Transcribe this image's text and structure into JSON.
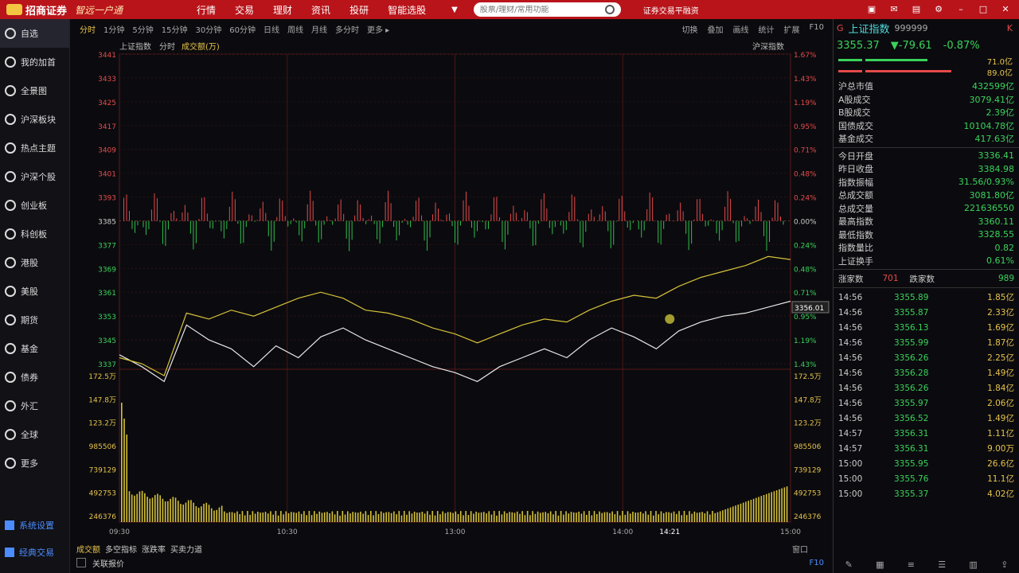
{
  "app": {
    "brand": "招商证券",
    "slogan": "智远一户通"
  },
  "nav": [
    "行情",
    "交易",
    "理财",
    "资讯",
    "投研",
    "智能选股"
  ],
  "search": {
    "placeholder": "股票/理财/常用功能"
  },
  "top_right": "证券交易平融资",
  "sidebar": {
    "items": [
      "自选",
      "我的加首",
      "全景图",
      "沪深板块",
      "热点主题",
      "沪深个股",
      "创业板",
      "科创板",
      "港股",
      "美股",
      "期货",
      "基金",
      "债券",
      "外汇",
      "全球",
      "更多"
    ],
    "bottom": [
      "系统设置",
      "经典交易"
    ]
  },
  "periods": [
    "分时",
    "1分钟",
    "5分钟",
    "15分钟",
    "30分钟",
    "60分钟",
    "日线",
    "周线",
    "月线",
    "多分时",
    "更多 ▸"
  ],
  "chart_tools": [
    "切换",
    "叠加",
    "画线",
    "统计",
    "扩展",
    "F10"
  ],
  "info": {
    "index_name": "上证指数",
    "mode": "分时",
    "indicator": "成交额(万)",
    "right_label": "沪深指数"
  },
  "chart_data": {
    "type": "line",
    "title": "上证指数 分时",
    "time_labels": [
      "09:30",
      "10:30",
      "13:00",
      "14:00",
      "14:21",
      "15:00"
    ],
    "price_ticks": [
      "3441",
      "3433",
      "3425",
      "3417",
      "3409",
      "3401",
      "3393",
      "3385",
      "3377",
      "3369",
      "3361",
      "3353",
      "3345",
      "3337"
    ],
    "pct_ticks": [
      "1.67%",
      "1.43%",
      "1.19%",
      "0.95%",
      "0.71%",
      "0.48%",
      "0.24%",
      "0.00%",
      "0.24%",
      "0.48%",
      "0.71%",
      "0.95%",
      "1.19%",
      "1.43%"
    ],
    "volume_ticks": [
      "172.5万",
      "147.8万",
      "123.2万",
      "985506",
      "739129",
      "492753",
      "246376"
    ],
    "prev_close": 3384.98,
    "current_price_label": "3356.01",
    "series": [
      {
        "name": "上证指数",
        "color": "#e8e8e8",
        "values": [
          3340,
          3336,
          3331,
          3350,
          3345,
          3342,
          3336,
          3343,
          3339,
          3346,
          3349,
          3345,
          3342,
          3339,
          3336,
          3334,
          3331,
          3336,
          3339,
          3342,
          3339,
          3345,
          3349,
          3346,
          3342,
          3348,
          3351,
          3353,
          3354,
          3356,
          3358
        ]
      },
      {
        "name": "均价",
        "color": "#d6c23a",
        "values": [
          3339,
          3337,
          3333,
          3354,
          3352,
          3355,
          3353,
          3356,
          3359,
          3361,
          3359,
          3355,
          3354,
          3352,
          3349,
          3347,
          3344,
          3347,
          3350,
          3352,
          3351,
          3355,
          3358,
          3360,
          3359,
          3363,
          3366,
          3368,
          3370,
          3373,
          3372
        ]
      }
    ]
  },
  "quote": {
    "flag": "G",
    "name": "上证指数",
    "code": "999999",
    "kline": "K",
    "price": "3355.37",
    "change": "▼-79.61",
    "pct": "-0.87%",
    "bar_up": "71.0亿",
    "bar_down": "89.0亿"
  },
  "quote_rows1": [
    {
      "label": "沪总市值",
      "value": "432599亿"
    },
    {
      "label": "A股成交",
      "value": "3079.41亿"
    },
    {
      "label": "B股成交",
      "value": "2.39亿"
    },
    {
      "label": "国债成交",
      "value": "10104.78亿"
    },
    {
      "label": "基金成交",
      "value": "417.63亿"
    }
  ],
  "quote_rows2": [
    {
      "label": "今日开盘",
      "value": "3336.41"
    },
    {
      "label": "昨日收盘",
      "value": "3384.98"
    },
    {
      "label": "指数振幅",
      "value": "31.56/0.93%"
    },
    {
      "label": "总成交额",
      "value": "3081.80亿"
    },
    {
      "label": "总成交量",
      "value": "221636550"
    },
    {
      "label": "最高指数",
      "value": "3360.11"
    },
    {
      "label": "最低指数",
      "value": "3328.55"
    },
    {
      "label": "指数量比",
      "value": "0.82"
    },
    {
      "label": "上证换手",
      "value": "0.61%"
    }
  ],
  "advance_decline": {
    "up_label": "涨家数",
    "up": "701",
    "down_label": "跌家数",
    "down": "989"
  },
  "ticks": [
    {
      "t": "14:56",
      "p": "3355.89",
      "v": "1.85亿"
    },
    {
      "t": "14:56",
      "p": "3355.87",
      "v": "2.33亿"
    },
    {
      "t": "14:56",
      "p": "3356.13",
      "v": "1.69亿"
    },
    {
      "t": "14:56",
      "p": "3355.99",
      "v": "1.87亿"
    },
    {
      "t": "14:56",
      "p": "3356.26",
      "v": "2.25亿"
    },
    {
      "t": "14:56",
      "p": "3356.28",
      "v": "1.49亿"
    },
    {
      "t": "14:56",
      "p": "3356.26",
      "v": "1.84亿"
    },
    {
      "t": "14:56",
      "p": "3355.97",
      "v": "2.06亿"
    },
    {
      "t": "14:56",
      "p": "3356.52",
      "v": "1.49亿"
    },
    {
      "t": "14:57",
      "p": "3356.31",
      "v": "1.11亿"
    },
    {
      "t": "14:57",
      "p": "3356.31",
      "v": "9.00万"
    },
    {
      "t": "15:00",
      "p": "3355.95",
      "v": "26.6亿"
    },
    {
      "t": "15:00",
      "p": "3355.76",
      "v": "11.1亿"
    },
    {
      "t": "15:00",
      "p": "3355.37",
      "v": "4.02亿"
    }
  ],
  "bottom_tabs": [
    "成交额",
    "多空指标",
    "涨跌率",
    "买卖力道"
  ],
  "bottom_right": "窗口",
  "status": {
    "text": "关联报价",
    "page": "F10"
  }
}
